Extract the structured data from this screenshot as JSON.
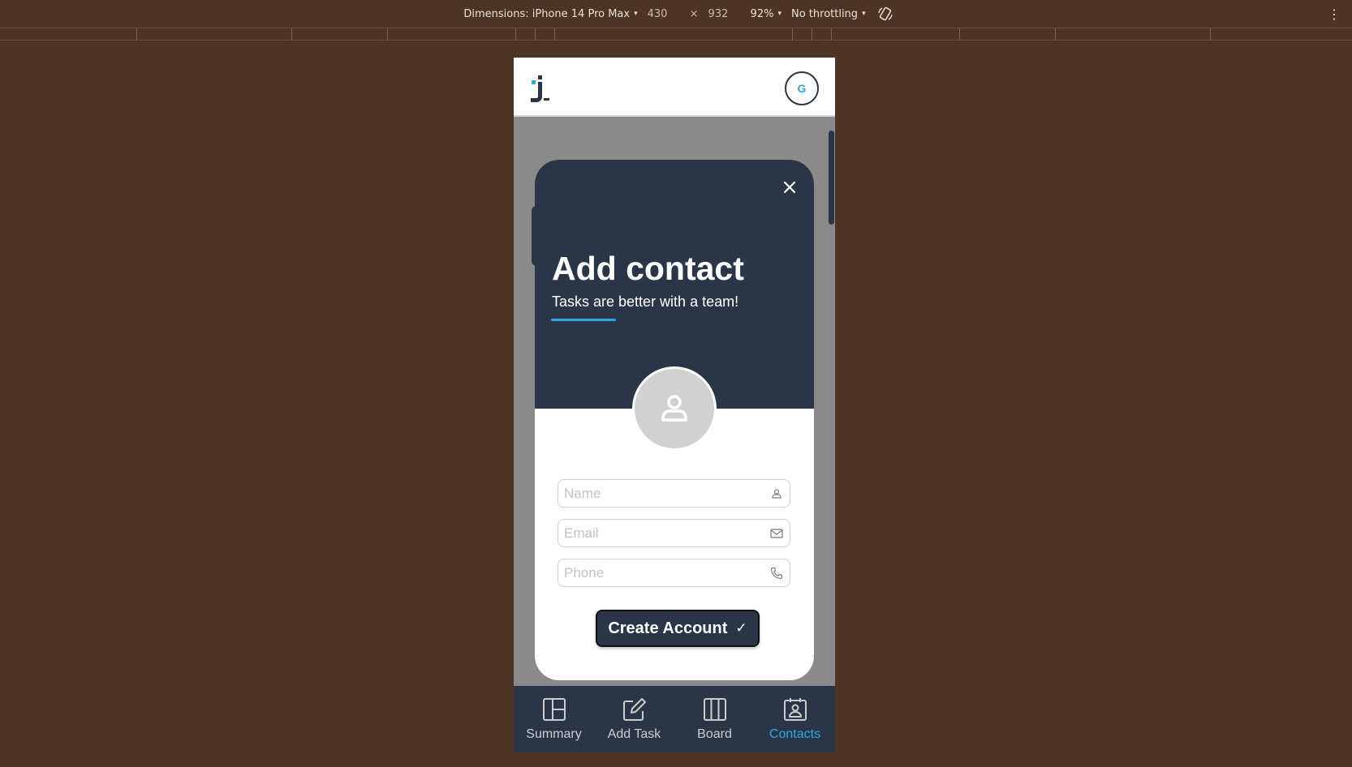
{
  "devtools": {
    "dimensions_label": "Dimensions: iPhone 14 Pro Max",
    "width": "430",
    "x": "×",
    "height": "932",
    "zoom": "92%",
    "throttling": "No throttling",
    "caret": "▾",
    "kebab": "⋮"
  },
  "header": {
    "avatar_initial": "G"
  },
  "modal": {
    "close": "×",
    "title": "Add contact",
    "subtitle": "Tasks are better with a team!",
    "fields": {
      "name_placeholder": "Name",
      "email_placeholder": "Email",
      "phone_placeholder": "Phone"
    },
    "create_label": "Create Account",
    "create_check": "✓"
  },
  "nav": {
    "items": [
      {
        "label": "Summary",
        "icon": "summary-icon"
      },
      {
        "label": "Add Task",
        "icon": "add-task-icon"
      },
      {
        "label": "Board",
        "icon": "board-icon"
      },
      {
        "label": "Contacts",
        "icon": "contacts-icon",
        "active": true
      }
    ]
  },
  "colors": {
    "page_bg": "#4d3424",
    "primary_dark": "#2a3647",
    "accent": "#29abe2"
  }
}
